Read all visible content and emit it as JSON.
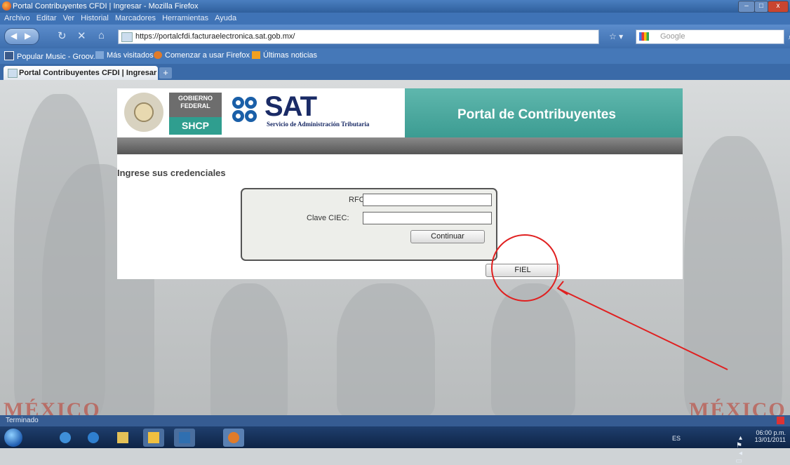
{
  "browser": {
    "window_title": "Portal Contribuyentes CFDI | Ingresar - Mozilla Firefox",
    "menu": [
      "Archivo",
      "Editar",
      "Ver",
      "Historial",
      "Marcadores",
      "Herramientas",
      "Ayuda"
    ],
    "url": "https://portalcfdi.facturaelectronica.sat.gob.mx/",
    "search_placeholder": "Google",
    "bookmarks": [
      {
        "label": "Popular Music - Groov...",
        "icon": "music-icon"
      },
      {
        "label": "Más visitados",
        "icon": "bookmark-icon"
      },
      {
        "label": "Comenzar a usar Firefox",
        "icon": "firefox-icon"
      },
      {
        "label": "Últimas noticias",
        "icon": "rss-icon"
      }
    ],
    "tab_title": "Portal Contribuyentes CFDI | Ingresar",
    "status": "Terminado"
  },
  "page": {
    "gobierno_line1": "Gobierno",
    "gobierno_line2": "Federal",
    "shcp": "SHCP",
    "sat": "SAT",
    "sat_subtitle": "Servicio de Administración Tributaria",
    "portal_title": "Portal de Contribuyentes",
    "heading": "Ingrese sus credenciales",
    "rfc_label": "RFC:",
    "ciec_label": "Clave CIEC:",
    "rfc_value": "",
    "ciec_value": "",
    "continue_label": "Continuar",
    "fiel_label": "FIEL",
    "background_text": "MÉXICO"
  },
  "annotation": {
    "color": "#e02020"
  },
  "taskbar": {
    "tray_lang": "ES",
    "time": "06:00 p.m.",
    "date": "13/01/2011"
  }
}
